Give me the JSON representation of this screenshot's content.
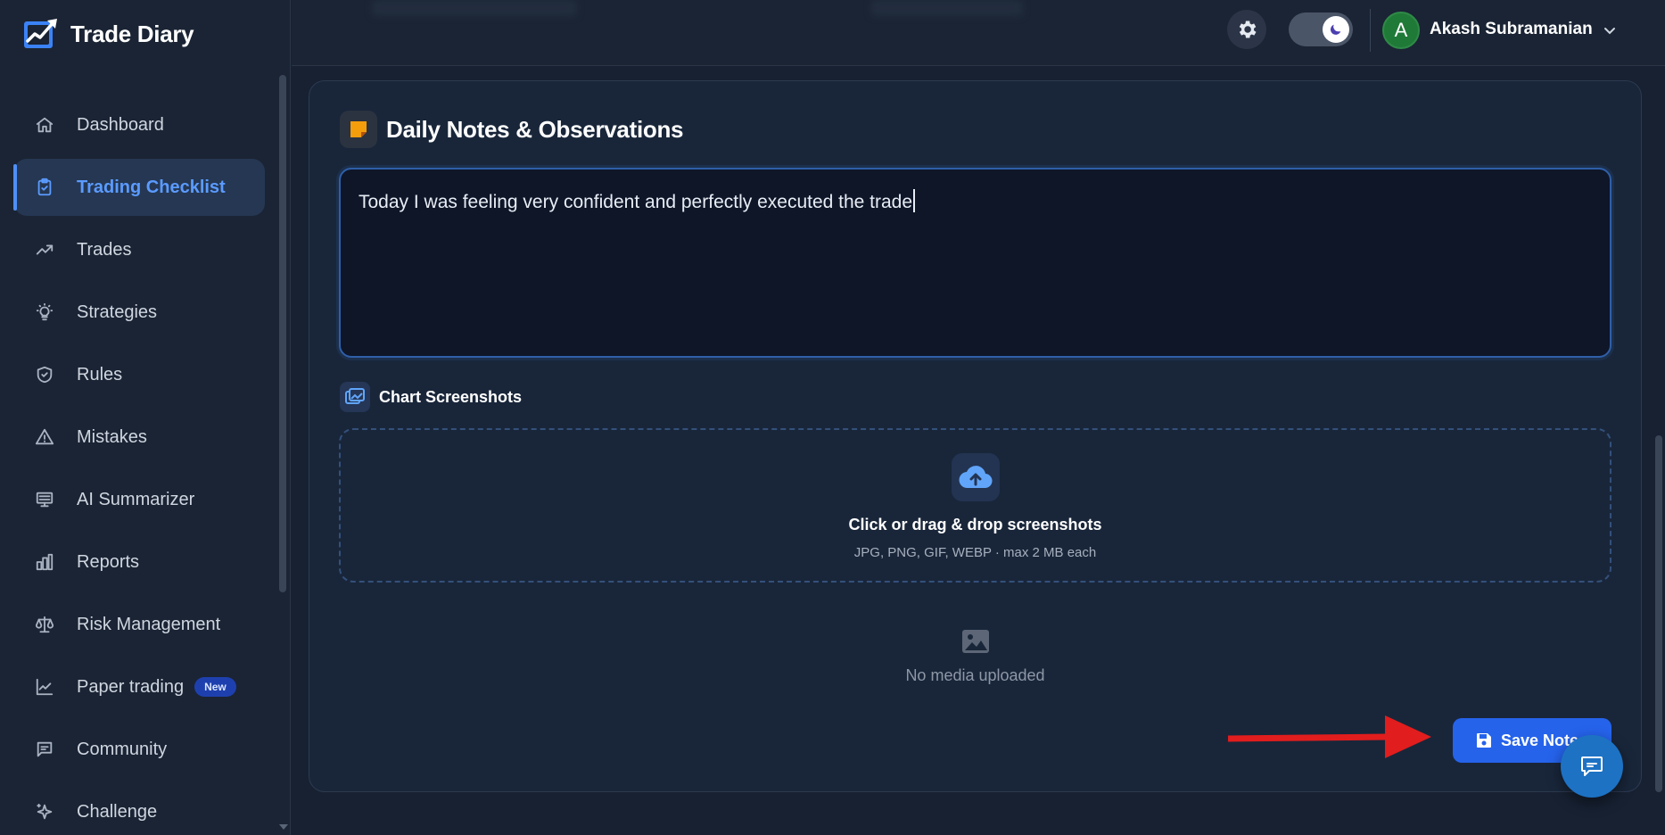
{
  "app": {
    "name": "Trade Diary"
  },
  "sidebar": {
    "items": [
      {
        "label": "Dashboard",
        "icon": "home-icon"
      },
      {
        "label": "Trading Checklist",
        "icon": "clipboard-check-icon",
        "active": true
      },
      {
        "label": "Trades",
        "icon": "trending-up-icon"
      },
      {
        "label": "Strategies",
        "icon": "lightbulb-icon"
      },
      {
        "label": "Rules",
        "icon": "shield-check-icon"
      },
      {
        "label": "Mistakes",
        "icon": "warning-triangle-icon"
      },
      {
        "label": "AI Summarizer",
        "icon": "monitor-icon"
      },
      {
        "label": "Reports",
        "icon": "bar-chart-icon"
      },
      {
        "label": "Risk Management",
        "icon": "scale-icon"
      },
      {
        "label": "Paper trading",
        "icon": "line-chart-icon",
        "badge": "New"
      },
      {
        "label": "Community",
        "icon": "message-icon"
      },
      {
        "label": "Challenge",
        "icon": "sparkle-icon"
      }
    ]
  },
  "header": {
    "user": {
      "initial": "A",
      "name": "Akash Subramanian"
    },
    "theme": "dark"
  },
  "notes": {
    "title": "Daily Notes & Observations",
    "text": "Today I was feeling very confident and perfectly executed the trade"
  },
  "screenshots": {
    "title": "Chart Screenshots",
    "dropzone_title": "Click or drag & drop screenshots",
    "dropzone_subtitle": "JPG, PNG, GIF, WEBP · max 2 MB each",
    "empty_text": "No media uploaded"
  },
  "actions": {
    "save_label": "Save Note"
  },
  "colors": {
    "accent": "#2563eb",
    "active_nav": "#5b9bff",
    "annotation_arrow": "#e11d1d",
    "avatar": "#1f7a37"
  }
}
